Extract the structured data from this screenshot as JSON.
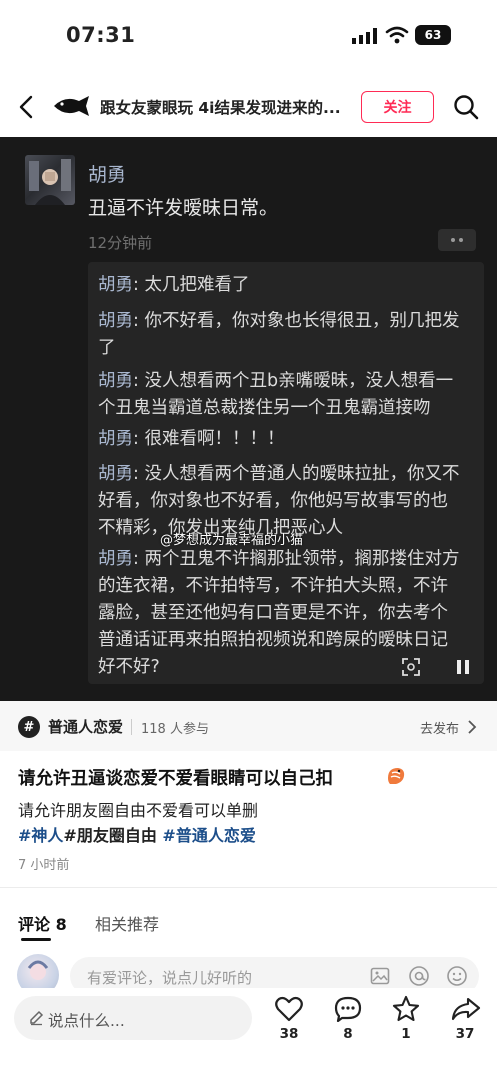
{
  "status_bar": {
    "time": "07:31",
    "battery": "63"
  },
  "nav": {
    "title": "跟女友蒙眼玩 4i结果发现进来的...",
    "follow_label": "关注"
  },
  "comment_shot": {
    "author": "胡勇",
    "text": "丑逼不许发暧昧日常。",
    "time": "12分钟前",
    "replies": [
      {
        "name": "胡勇",
        "text": ": 太几把难看了"
      },
      {
        "name": "胡勇",
        "text": ": 你不好看，你对象也长得很丑，别几把发",
        "cont": "了"
      },
      {
        "name": "胡勇",
        "text": ": 没人想看两个丑b亲嘴暧昧，没人想看一",
        "cont": "个丑鬼当霸道总裁搂住另一个丑鬼霸道接吻"
      },
      {
        "name": "胡勇",
        "text": ": 很难看啊！！！！"
      },
      {
        "name": "胡勇",
        "text": ": 没人想看两个普通人的暧昧拉扯，你又不",
        "cont": "好看，你对象也不好看，你他妈写故事写的也",
        "cont2": "不精彩，你发出来纯几把恶心人"
      },
      {
        "name": "胡勇",
        "text": ": 两个丑鬼不许搁那扯领带，搁那搂住对方",
        "cont": "的连衣裙，不许拍特写，不许拍大头照，不许",
        "cont2": "露脸，甚至还他妈有口音更是不许，你去考个",
        "cont3": "普通话证再来拍照拍视频说和跨屎的暧昧日记",
        "cont4": "好不好?"
      }
    ],
    "watermark": "@梦想成为最幸福的小猫"
  },
  "topic": {
    "name": "普通人恋爱",
    "count": "118 人参与",
    "action": "去发布"
  },
  "post": {
    "title": "请允许丑逼谈恋爱不爱看眼睛可以自己扣",
    "body": "请允许朋友圈自由不爱看可以单删",
    "tags": [
      "#神人",
      "#朋友圈自由",
      "#普通人恋爱"
    ],
    "date": "7 小时前"
  },
  "tabs": {
    "comments": "评论 8",
    "related": "相关推荐"
  },
  "comment_input": {
    "placeholder": "有爱评论，说点儿好听的"
  },
  "bottom_bar": {
    "say": "说点什么...",
    "likes": "38",
    "comments": "8",
    "stars": "1",
    "shares": "37"
  }
}
